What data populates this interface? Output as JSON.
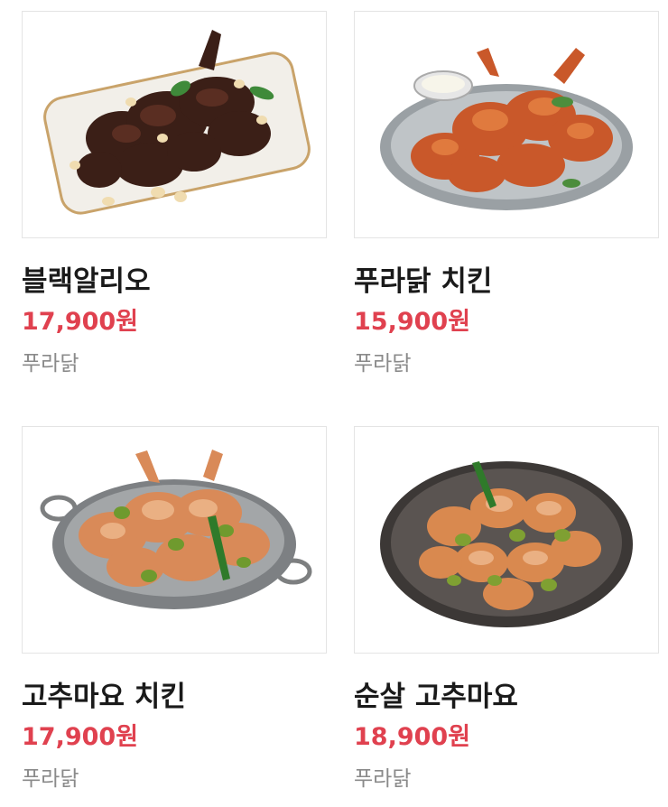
{
  "products": [
    {
      "name": "블랙알리오",
      "price": "17,900원",
      "brand": "푸라닭",
      "image_icon": "black-alio-chicken-platter-image"
    },
    {
      "name": "푸라닭 치킨",
      "price": "15,900원",
      "brand": "푸라닭",
      "image_icon": "puradak-fried-chicken-tray-image"
    },
    {
      "name": "고추마요 치킨",
      "price": "17,900원",
      "brand": "푸라닭",
      "image_icon": "gochu-mayo-chicken-pan-image"
    },
    {
      "name": "순살 고추마요",
      "price": "18,900원",
      "brand": "푸라닭",
      "image_icon": "boneless-gochu-mayo-plate-image"
    }
  ],
  "colors": {
    "price": "#e0414f",
    "name": "#1a1a1a",
    "brand": "#8a8a8a",
    "border": "#e4e4e4"
  }
}
